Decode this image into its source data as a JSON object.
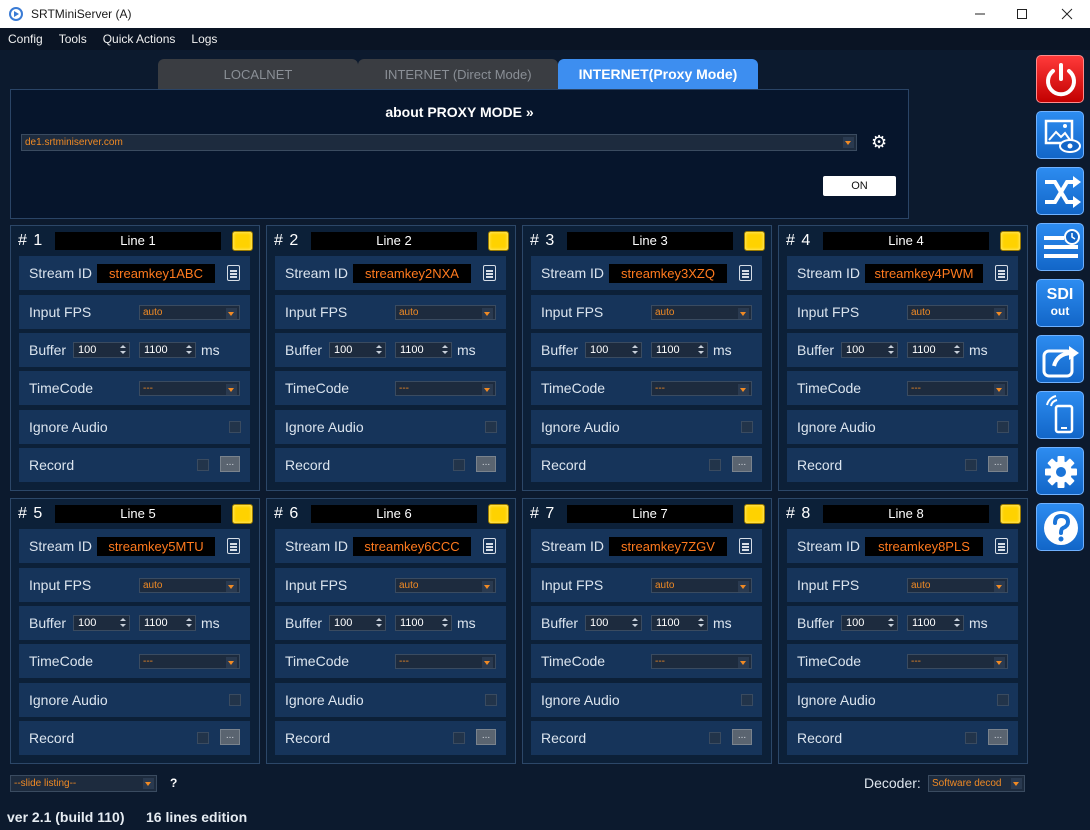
{
  "window": {
    "title": "SRTMiniServer (A)"
  },
  "menu": [
    "Config",
    "Tools",
    "Quick Actions",
    "Logs"
  ],
  "tabs": [
    {
      "label": "LOCALNET",
      "active": false
    },
    {
      "label": "INTERNET (Direct Mode)",
      "active": false
    },
    {
      "label": "INTERNET(Proxy Mode)",
      "active": true
    }
  ],
  "proxy": {
    "title": "about PROXY MODE »",
    "server": "de1.srtminiserver.com",
    "toggle_label": "ON"
  },
  "row_labels": {
    "stream_id": "Stream ID",
    "input_fps": "Input FPS",
    "buffer": "Buffer",
    "buffer_unit": "ms",
    "timecode": "TimeCode",
    "ignore_audio": "Ignore Audio",
    "record": "Record",
    "record_button": "..."
  },
  "lines": [
    {
      "num": "# 1",
      "name": "Line 1",
      "stream_id": "streamkey1ABC",
      "fps": "auto",
      "buffer_min": "100",
      "buffer_max": "1100",
      "timecode": "---"
    },
    {
      "num": "# 2",
      "name": "Line 2",
      "stream_id": "streamkey2NXA",
      "fps": "auto",
      "buffer_min": "100",
      "buffer_max": "1100",
      "timecode": "---"
    },
    {
      "num": "# 3",
      "name": "Line 3",
      "stream_id": "streamkey3XZQ",
      "fps": "auto",
      "buffer_min": "100",
      "buffer_max": "1100",
      "timecode": "---"
    },
    {
      "num": "# 4",
      "name": "Line 4",
      "stream_id": "streamkey4PWM",
      "fps": "auto",
      "buffer_min": "100",
      "buffer_max": "1100",
      "timecode": "---"
    },
    {
      "num": "# 5",
      "name": "Line 5",
      "stream_id": "streamkey5MTU",
      "fps": "auto",
      "buffer_min": "100",
      "buffer_max": "1100",
      "timecode": "---"
    },
    {
      "num": "# 6",
      "name": "Line 6",
      "stream_id": "streamkey6CCC",
      "fps": "auto",
      "buffer_min": "100",
      "buffer_max": "1100",
      "timecode": "---"
    },
    {
      "num": "# 7",
      "name": "Line 7",
      "stream_id": "streamkey7ZGV",
      "fps": "auto",
      "buffer_min": "100",
      "buffer_max": "1100",
      "timecode": "---"
    },
    {
      "num": "# 8",
      "name": "Line 8",
      "stream_id": "streamkey8PLS",
      "fps": "auto",
      "buffer_min": "100",
      "buffer_max": "1100",
      "timecode": "---"
    }
  ],
  "toolbar": {
    "sdi_label": "SDI",
    "sdi_sub": "out",
    "icons": [
      "power-icon",
      "preview-icon",
      "shuffle-icon",
      "schedule-icon",
      "sdi-out-icon",
      "share-icon",
      "mobile-icon",
      "settings-icon",
      "help-icon"
    ]
  },
  "bottom": {
    "slide_listing": "--slide listing--",
    "help": "?",
    "decoder_label": "Decoder:",
    "decoder_value": "Software decod",
    "version": "ver 2.1 (build 110)",
    "edition": "16 lines edition"
  },
  "colors": {
    "background": "#0c1a2e",
    "accent": "#3d8ef0",
    "stream_id_text": "#ff7a1e",
    "status_indicator": "#ffd200",
    "power": "#e00000"
  }
}
